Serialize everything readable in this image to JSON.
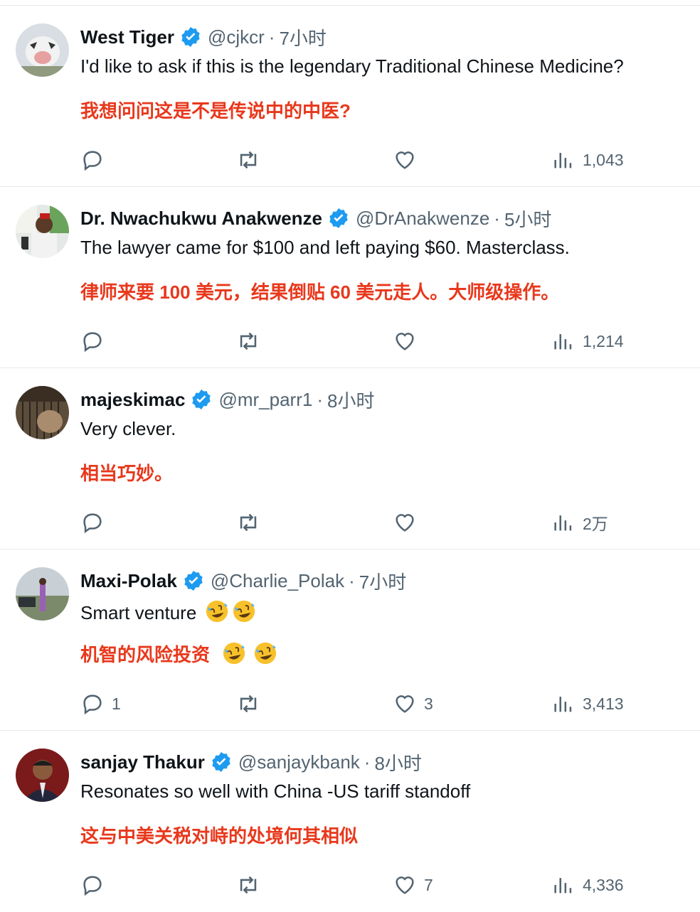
{
  "tweets": [
    {
      "name": "West Tiger",
      "handle": "@cjkcr",
      "time": "7小时",
      "text_en": "I'd like to ask if this is the legendary Traditional Chinese Medicine?",
      "text_zh": "我想问问这是不是传说中的中医?",
      "reply_count": "",
      "like_count": "",
      "views": "1,043",
      "avatar_colors": [
        "#cfd6dc",
        "#9aa3ab"
      ]
    },
    {
      "name": "Dr. Nwachukwu Anakwenze",
      "handle": "@DrAnakwenze",
      "time": "5小时",
      "text_en": "The lawyer came for $100 and left paying $60. Masterclass.",
      "text_zh": "律师来要 100 美元，结果倒贴 60 美元走人。大师级操作。",
      "reply_count": "",
      "like_count": "",
      "views": "1,214",
      "avatar_colors": [
        "#c9d3c0",
        "#7a5a3c"
      ]
    },
    {
      "name": "majeskimac",
      "handle": "@mr_parr1",
      "time": "8小时",
      "text_en": "Very clever.",
      "text_zh": "相当巧妙。",
      "reply_count": "",
      "like_count": "",
      "views": "2万",
      "avatar_colors": [
        "#6b5a45",
        "#3a3128"
      ]
    },
    {
      "name": "Maxi-Polak",
      "handle": "@Charlie_Polak",
      "time": "7小时",
      "text_en": "Smart venture",
      "text_zh": "机智的风险投资",
      "reply_count": "1",
      "like_count": "3",
      "views": "3,413",
      "avatar_colors": [
        "#b9c2c8",
        "#5c6a52"
      ]
    },
    {
      "name": "sanjay Thakur",
      "handle": "@sanjaykbank",
      "time": "8小时",
      "text_en": "Resonates so well with China -US tariff standoff",
      "text_zh": "这与中美关税对峙的处境何其相似",
      "reply_count": "",
      "like_count": "7",
      "views": "4,336",
      "avatar_colors": [
        "#8a1f1f",
        "#2b2b3a"
      ]
    }
  ],
  "colors": {
    "accent_verified": "#1d9bf0",
    "translation_text": "#e8381c",
    "secondary_text": "#536471"
  },
  "icons": [
    "verified-badge-icon",
    "reply-icon",
    "retweet-icon",
    "like-icon",
    "views-icon",
    "rofl-emoji-icon"
  ]
}
